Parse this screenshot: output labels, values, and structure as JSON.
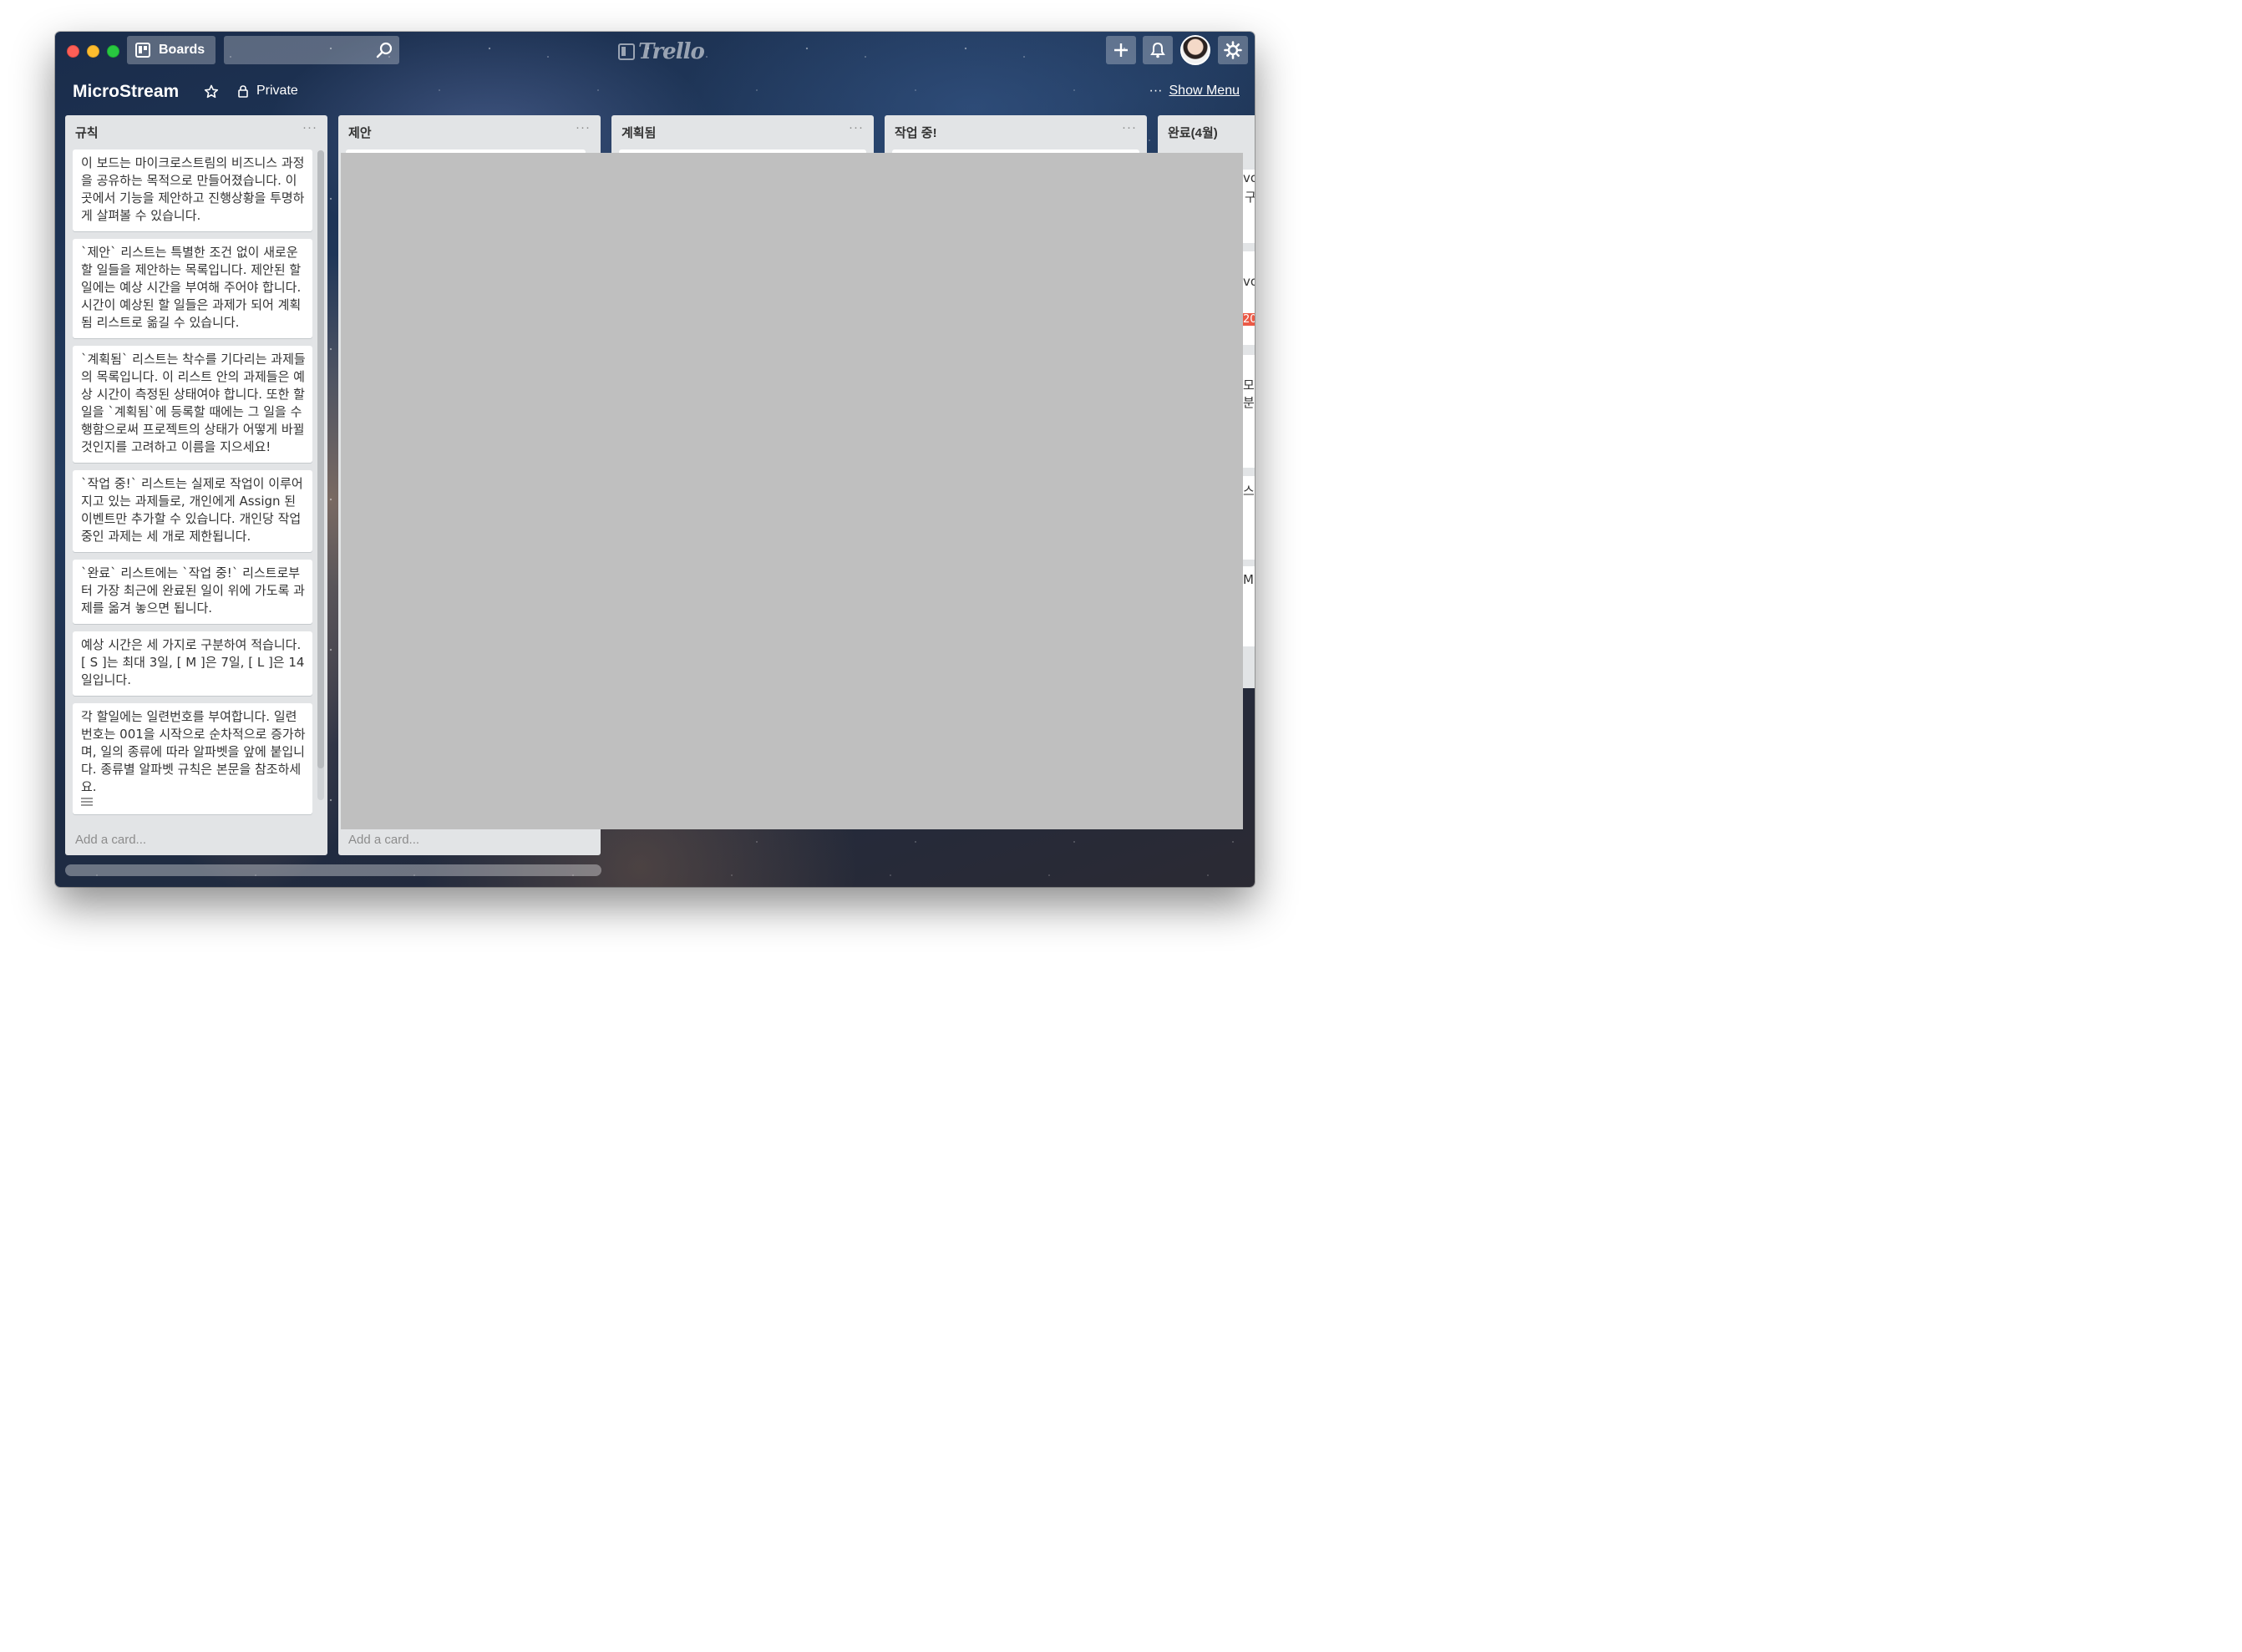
{
  "header": {
    "boards_label": "Boards",
    "search": {
      "value": "",
      "placeholder": ""
    },
    "logo_text": "Trello"
  },
  "board": {
    "title": "MicroStream",
    "visibility": "Private",
    "show_menu_label": "Show Menu"
  },
  "lists": [
    {
      "title": "규칙",
      "cards": [
        "이 보드는 마이크로스트림의 비즈니스 과정을 공유하는 목적으로 만들어졌습니다. 이곳에서 기능을 제안하고 진행상황을 투명하게 살펴볼 수 있습니다.",
        "`제안` 리스트는 특별한 조건 없이 새로운 할 일들을 제안하는 목록입니다. 제안된 할 일에는 예상 시간을 부여해 주어야 합니다. 시간이 예상된 할 일들은 과제가 되어 계획됨 리스트로 옮길 수 있습니다.",
        "`계획됨` 리스트는 착수를 기다리는 과제들의 목록입니다. 이 리스트 안의 과제들은 예상 시간이 측정된 상태여야 합니다. 또한 할 일을 `계획됨`에 등록할 때에는 그 일을 수행함으로써 프로젝트의 상태가 어떻게 바뀔 것인지를 고려하고 이름을 지으세요!",
        "`작업 중!` 리스트는 실제로 작업이 이루어지고 있는 과제들로, 개인에게 Assign 된 이벤트만 추가할 수 있습니다. 개인당 작업 중인 과제는 세 개로 제한됩니다.",
        "`완료` 리스트에는 `작업 중!` 리스트로부터 가장 최근에 완료된 일이 위에 가도록 과제를 옮겨 놓으면 됩니다.",
        "예상 시간은 세 가지로 구분하여 적습니다. [ S ]는 최대 3일, [ M ]은 7일, [ L ]은 14일입니다.",
        "각 할일에는 일련번호를 부여합니다. 일련번호는 001을 시작으로 순차적으로 증가하며, 일의 종류에 따라 알파벳을 앞에 붙입니다. 종류별 알파벳 규칙은 본문을 참조하세요."
      ],
      "add_card": "Add a card..."
    },
    {
      "title": "제안",
      "add_card": "Add a card..."
    },
    {
      "title": "계획됨"
    },
    {
      "title": "작업 중!"
    },
    {
      "title": "완료(4월)"
    }
  ],
  "peek_fragments": [
    "vo",
    "구",
    "vo",
    "20",
    "모",
    "분",
    "스",
    "M"
  ],
  "menu_glyph": "···",
  "colors": {
    "label_red": "#eb5a46",
    "list_bg": "#e2e4e6"
  }
}
